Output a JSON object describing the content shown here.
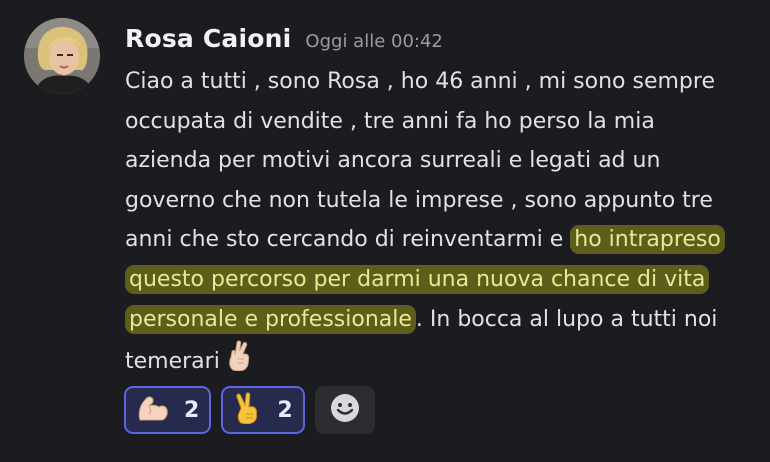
{
  "message": {
    "author": "Rosa Caioni",
    "timestamp": "Oggi alle 00:42",
    "lines": [
      {
        "plain": "Ciao a tutti , sono Rosa , ho 46 anni , mi sono sempre",
        "highlight": ""
      },
      {
        "plain": "occupata di vendite , tre anni fa ho perso la mia",
        "highlight": ""
      },
      {
        "plain": "azienda per motivi ancora surreali e legati ad un",
        "highlight": ""
      },
      {
        "plain": "governo che non tutela le imprese , sono appunto tre",
        "highlight": ""
      },
      {
        "plain": "anni che sto cercando di reinventarmi e ",
        "highlight": "ho intrapreso"
      },
      {
        "plain": "",
        "highlight": "questo percorso per darmi una nuova chance di vita"
      },
      {
        "plain": "",
        "highlight": "personale e professionale",
        "after": ". In bocca al lupo a tutti noi"
      },
      {
        "plain": "temerari",
        "highlight": ""
      }
    ],
    "inline_emoji": "crossed-fingers-emoji"
  },
  "reactions": [
    {
      "emoji": "flexed-biceps-emoji",
      "count": "2"
    },
    {
      "emoji": "victory-hand-emoji",
      "count": "2"
    }
  ],
  "add_reaction_icon": "smiley-add-reaction-icon",
  "colors": {
    "background": "#1b1c20",
    "text": "#dfe1e5",
    "highlight": "#5e5e1c",
    "reaction_border": "#5c64e0"
  }
}
